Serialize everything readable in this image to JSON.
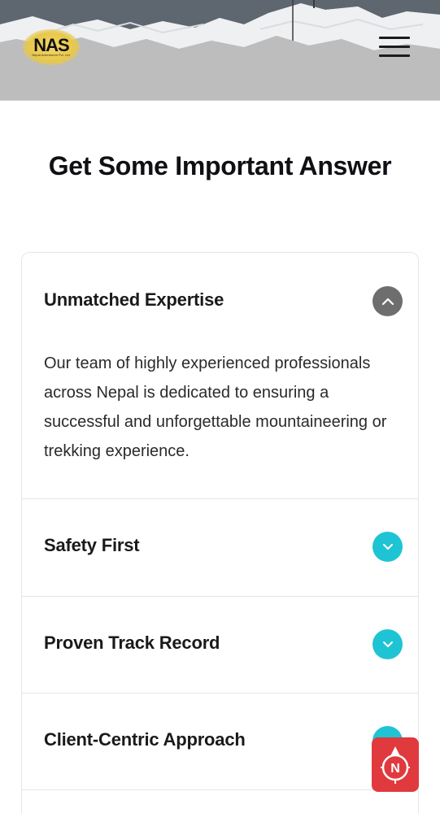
{
  "header": {
    "logo_text": "NAS",
    "logo_subtext": "Nepal Adventures Pvt. Ltd."
  },
  "page": {
    "title": "Get Some Important Answer"
  },
  "faq": {
    "items": [
      {
        "question": "Unmatched Expertise",
        "answer": "Our team of highly experienced professionals across Nepal is dedicated to ensuring a successful and unforgettable mountaineering or trekking experience.",
        "expanded": true
      },
      {
        "question": "Safety First",
        "expanded": false
      },
      {
        "question": "Proven Track Record",
        "expanded": false
      },
      {
        "question": "Client-Centric Approach",
        "expanded": false
      }
    ]
  },
  "colors": {
    "toggle_open": "#6e6e6e",
    "toggle_closed": "#1fc4d4",
    "fab": "#e03a3e"
  },
  "icons": {
    "menu": "hamburger-menu-icon",
    "expanded": "chevron-up-icon",
    "collapsed": "chevron-down-icon",
    "fab": "compass-icon"
  }
}
